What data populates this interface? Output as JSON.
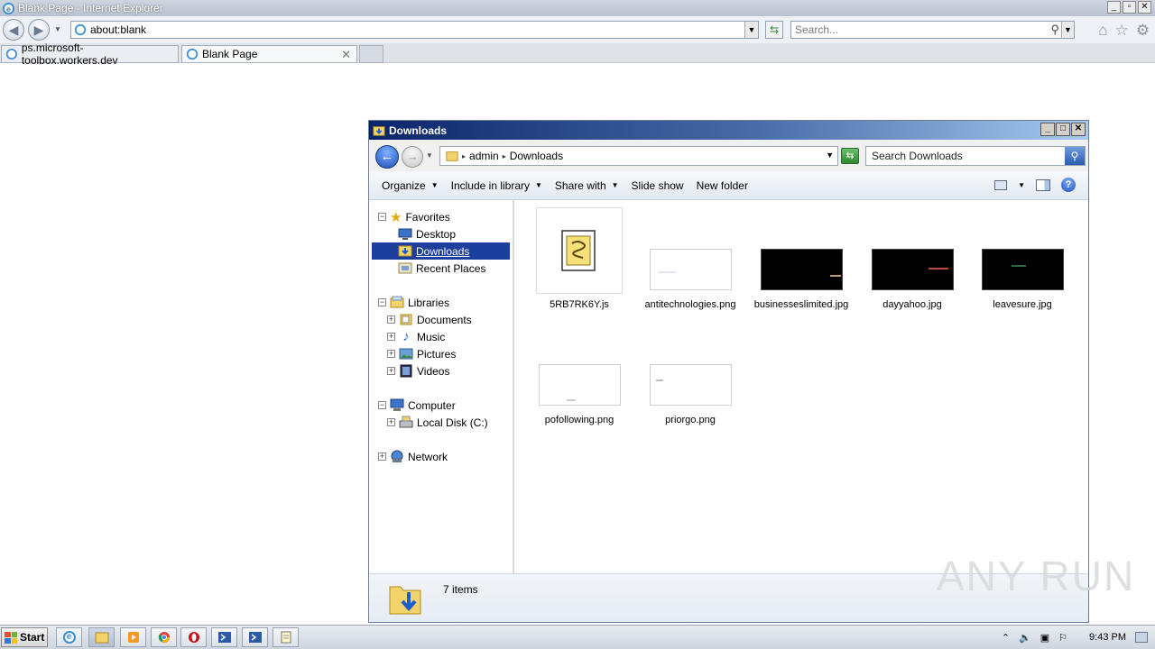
{
  "ie": {
    "title": "Blank Page - Internet Explorer",
    "address": "about:blank",
    "search_placeholder": "Search...",
    "tabs": [
      {
        "label": "ps.microsoft-toolbox.workers.dev"
      },
      {
        "label": "Blank Page"
      }
    ]
  },
  "explorer": {
    "title": "Downloads",
    "breadcrumb": [
      "admin",
      "Downloads"
    ],
    "search_placeholder": "Search Downloads",
    "commands": [
      "Organize",
      "Include in library",
      "Share with",
      "Slide show",
      "New folder"
    ],
    "nav": {
      "favorites": "Favorites",
      "desktop": "Desktop",
      "downloads": "Downloads",
      "recent": "Recent Places",
      "libraries": "Libraries",
      "documents": "Documents",
      "music": "Music",
      "pictures": "Pictures",
      "videos": "Videos",
      "computer": "Computer",
      "localdisk": "Local Disk (C:)",
      "network": "Network"
    },
    "files": [
      {
        "name": "5RB7RK6Y.js"
      },
      {
        "name": "antitechnologies.png"
      },
      {
        "name": "businesseslimited.jpg"
      },
      {
        "name": "dayyahoo.jpg"
      },
      {
        "name": "leavesure.jpg"
      },
      {
        "name": "pofollowing.png"
      },
      {
        "name": "priorgo.png"
      }
    ],
    "item_count": "7 items"
  },
  "taskbar": {
    "start": "Start",
    "clock": "9:43 PM"
  },
  "watermark": "ANY RUN",
  "colors": {
    "selection": "#1c3e9c",
    "explorer_title": "#0a246a"
  }
}
